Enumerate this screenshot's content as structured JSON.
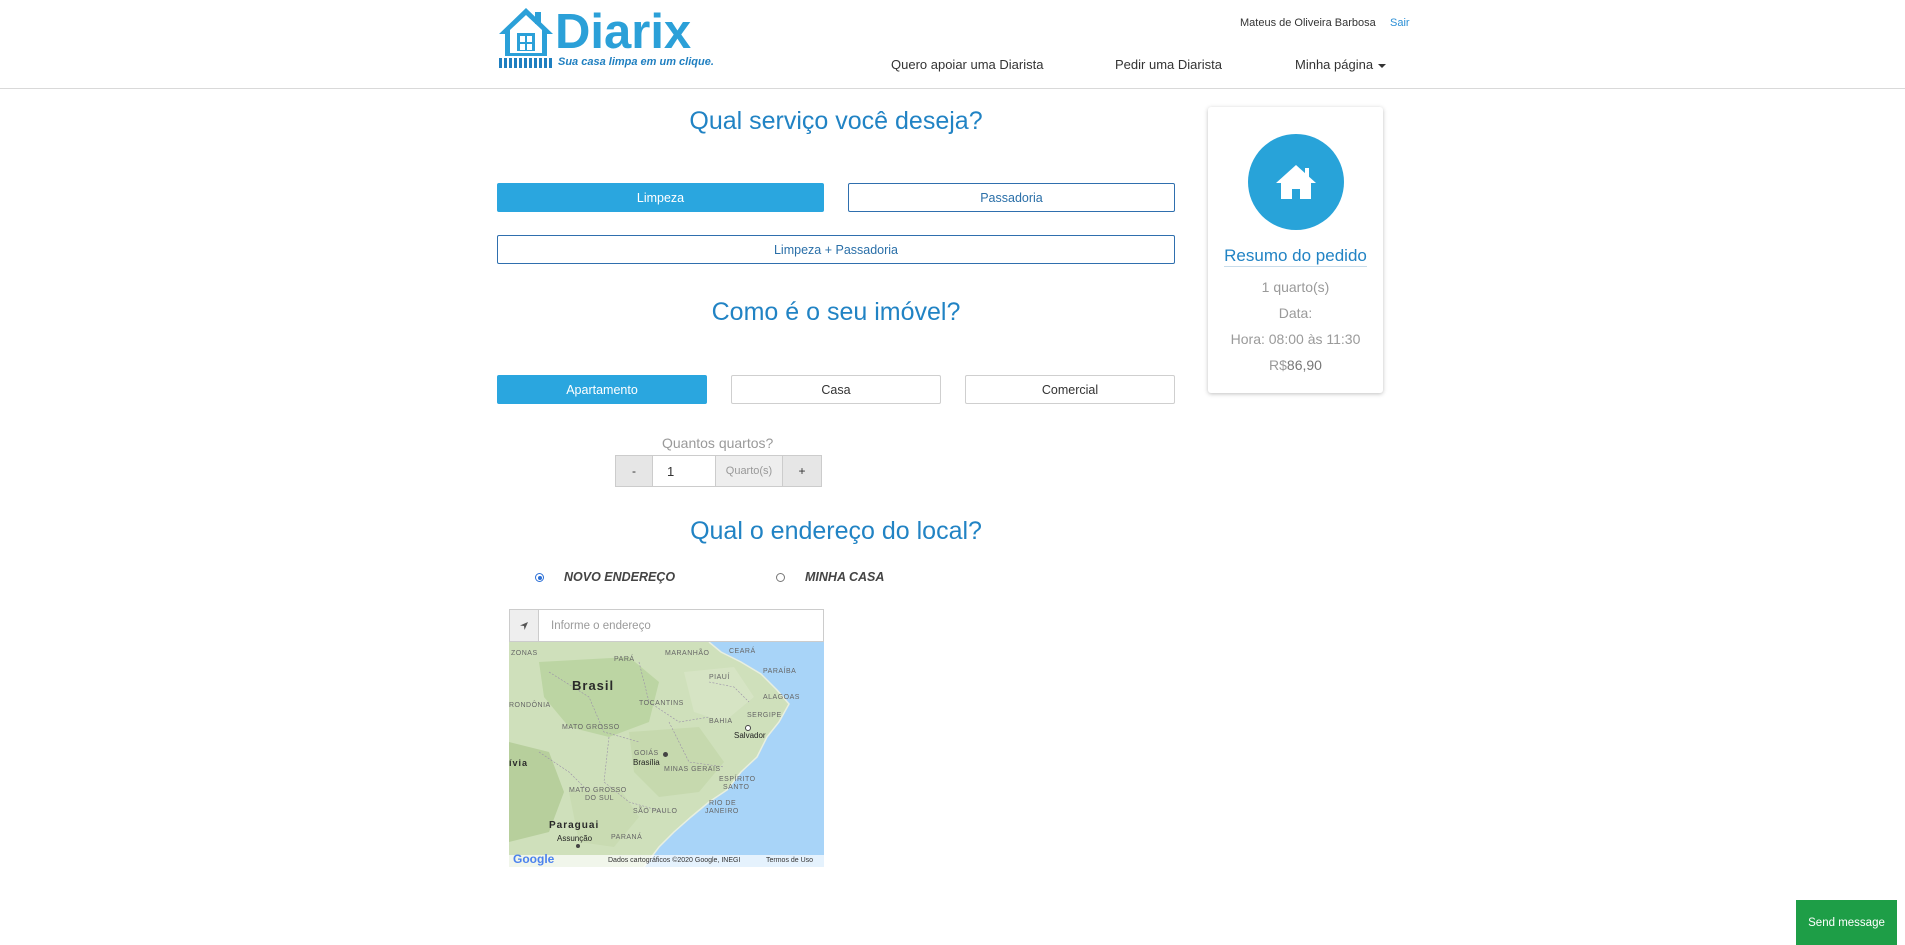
{
  "header": {
    "logo_text": "Diarix",
    "logo_tagline": "Sua casa limpa em um clique.",
    "user_name": "Mateus de Oliveira Barbosa",
    "logout_label": "Sair",
    "nav": [
      "Quero apoiar uma Diarista",
      "Pedir uma Diarista",
      "Minha página"
    ]
  },
  "service": {
    "title": "Qual serviço você deseja?",
    "options": [
      "Limpeza",
      "Passadoria",
      "Limpeza + Passadoria"
    ],
    "selected": "Limpeza"
  },
  "property": {
    "title": "Como é o seu imóvel?",
    "options": [
      "Apartamento",
      "Casa",
      "Comercial"
    ],
    "selected": "Apartamento",
    "rooms_label": "Quantos quartos?",
    "decrement_label": "-",
    "increment_label": "+",
    "rooms_value": "1",
    "rooms_unit": "Quarto(s)"
  },
  "address": {
    "title": "Qual o endereço do local?",
    "radio_new": "NOVO ENDEREÇO",
    "radio_home": "MINHA CASA",
    "selected": "NOVO ENDEREÇO",
    "placeholder": "Informe o endereço"
  },
  "map": {
    "country_brasil": "Brasil",
    "country_paraguai": "Paraguai",
    "country_bolivia": "ívia",
    "states": [
      "ZONAS",
      "PARÁ",
      "MARANHÃO",
      "CEARÁ",
      "PIAUÍ",
      "PARAÍBA",
      "ALAGOAS",
      "SERGIPE",
      "TOCANTINS",
      "RONDÔNIA",
      "MATO GROSSO",
      "BAHIA",
      "GOIÁS",
      "MINAS GERAIS",
      "ESPÍRITO",
      "SANTO",
      "MATO GROSSO",
      "DO SUL",
      "SÃO PAULO",
      "RIO DE",
      "JANEIRO",
      "PARANÁ"
    ],
    "cities": [
      "Salvador",
      "Brasília",
      "Assunção"
    ],
    "google": "Google",
    "attribution": "Dados cartográficos ©2020 Google, INEGI",
    "terms": "Termos de Uso"
  },
  "summary": {
    "title": "Resumo do pedido",
    "rooms": "1 quarto(s)",
    "date": "Data:",
    "time": "Hora: 08:00 às 11:30",
    "price_prefix": "R$",
    "price_value": "86,90"
  },
  "chat": {
    "send_label": "Send message"
  },
  "colors": {
    "primary": "#2aa6df",
    "title_blue": "#2183c4",
    "send_green": "#1e9e47"
  }
}
